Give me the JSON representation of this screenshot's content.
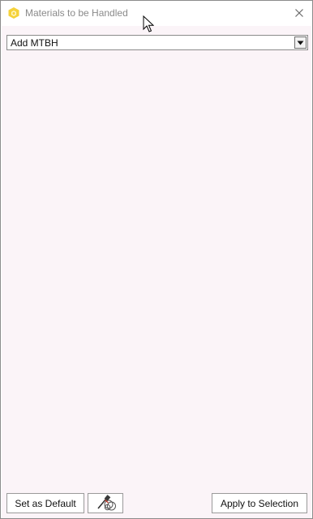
{
  "window": {
    "title": "Materials to be Handled",
    "icon": "hexagon-app-icon",
    "close_icon": "close-icon"
  },
  "combo": {
    "value": "Add MTBH",
    "arrow_icon": "chevron-down-icon"
  },
  "footer": {
    "set_default_label": "Set as Default",
    "picker_icon": "eyedropper-icon",
    "apply_label": "Apply to Selection"
  },
  "colors": {
    "content_background": "#fbf4f8",
    "app_icon": "#f5d23a",
    "title_text": "#8a8a8a"
  }
}
